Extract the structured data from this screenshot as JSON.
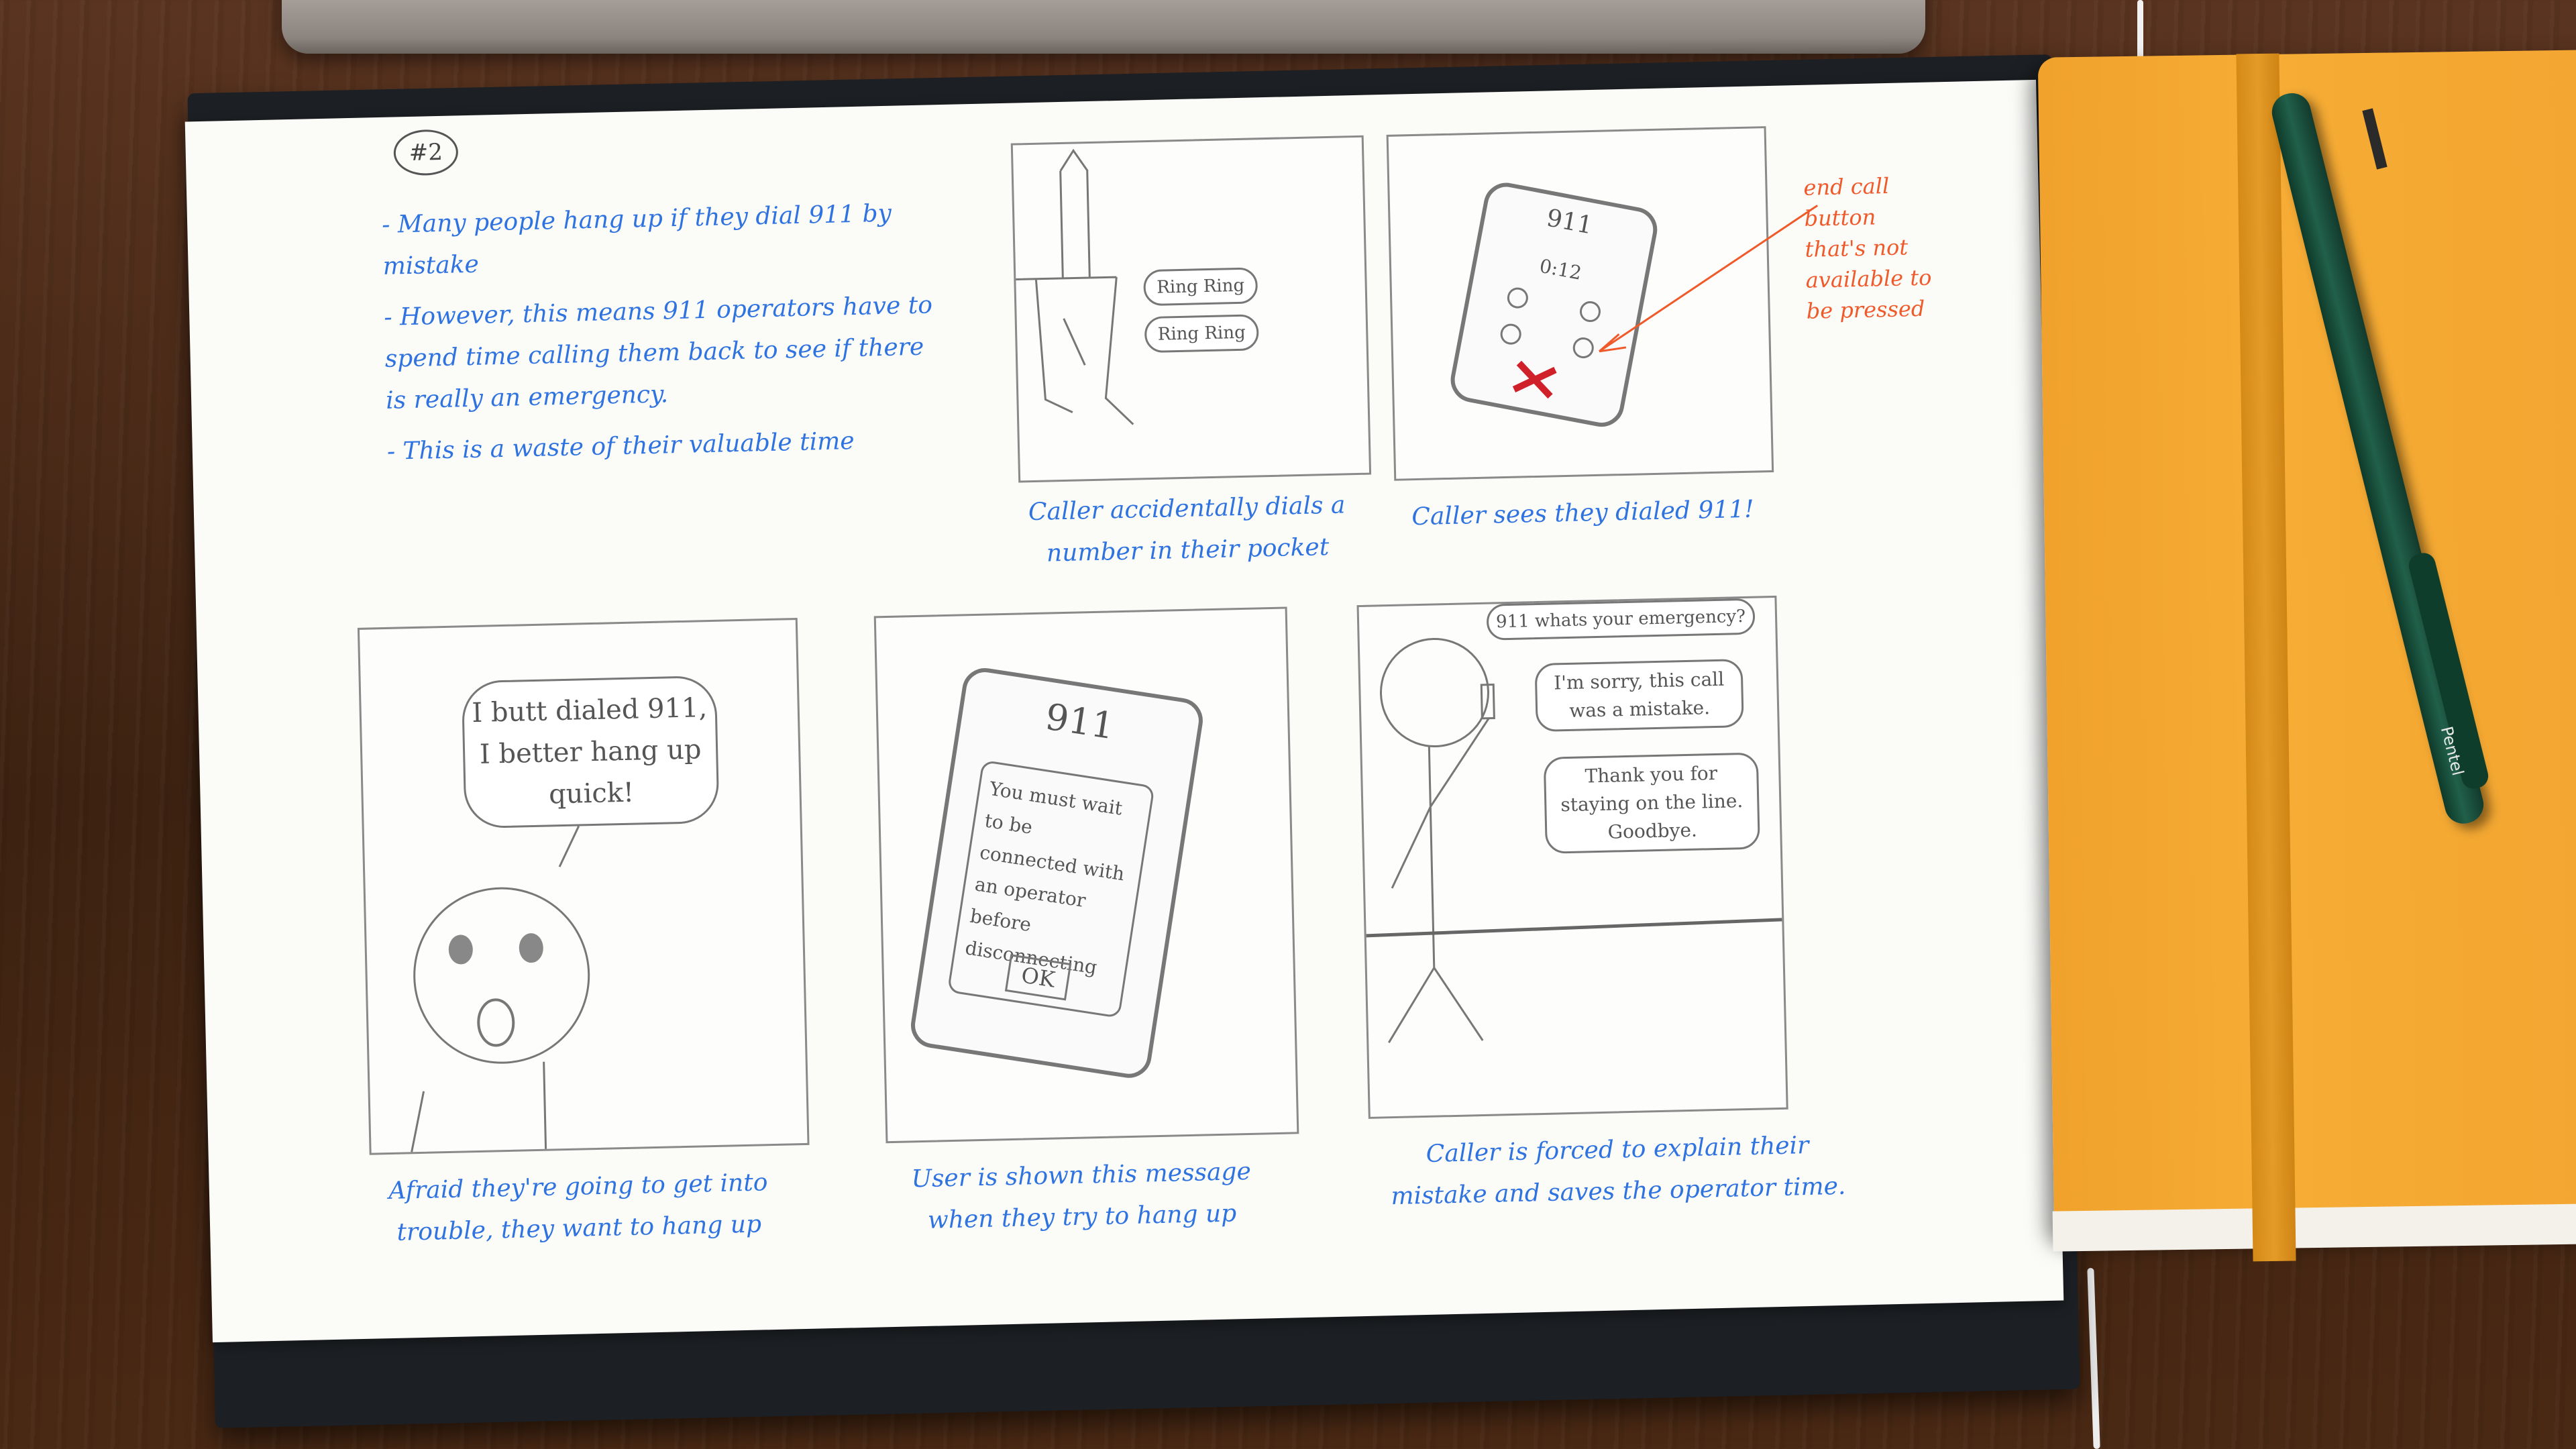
{
  "sheet": {
    "number": "#2",
    "notes": [
      "- Many people hang up if they dial 911 by mistake",
      "- However, this means 911 operators have to spend time calling them back to see if there is really an emergency.",
      "- This is a waste of their valuable time"
    ]
  },
  "panels": [
    {
      "caption": "Caller accidentally dials a number in their pocket",
      "ring_1": "Ring Ring",
      "ring_2": "Ring Ring"
    },
    {
      "caption": "Caller sees they dialed 911!",
      "phone_number": "911",
      "phone_timer": "0:12",
      "annotation": "end call button that's not available to be pressed"
    },
    {
      "caption": "Afraid they're going to get into trouble, they want to hang up",
      "bubble": "I butt dialed 911, I better hang up quick!"
    },
    {
      "caption": "User is shown this message when they try to hang up",
      "phone_number": "911",
      "dialog": "You must wait to be connected with an operator before disconnecting",
      "ok_label": "OK"
    },
    {
      "caption": "Caller is forced to explain their mistake and saves the operator time.",
      "operator_line": "911 whats your emergency?",
      "caller_line": "I'm sorry, this call was a mistake.",
      "operator_reply": "Thank you for staying on the line. Goodbye."
    }
  ],
  "pen_brand": "Pentel",
  "colors": {
    "ink_blue": "#2f73e0",
    "ink_red": "#f05a2a",
    "notebook_orange": "#f6ac35",
    "table_wood": "#4a2a16"
  }
}
